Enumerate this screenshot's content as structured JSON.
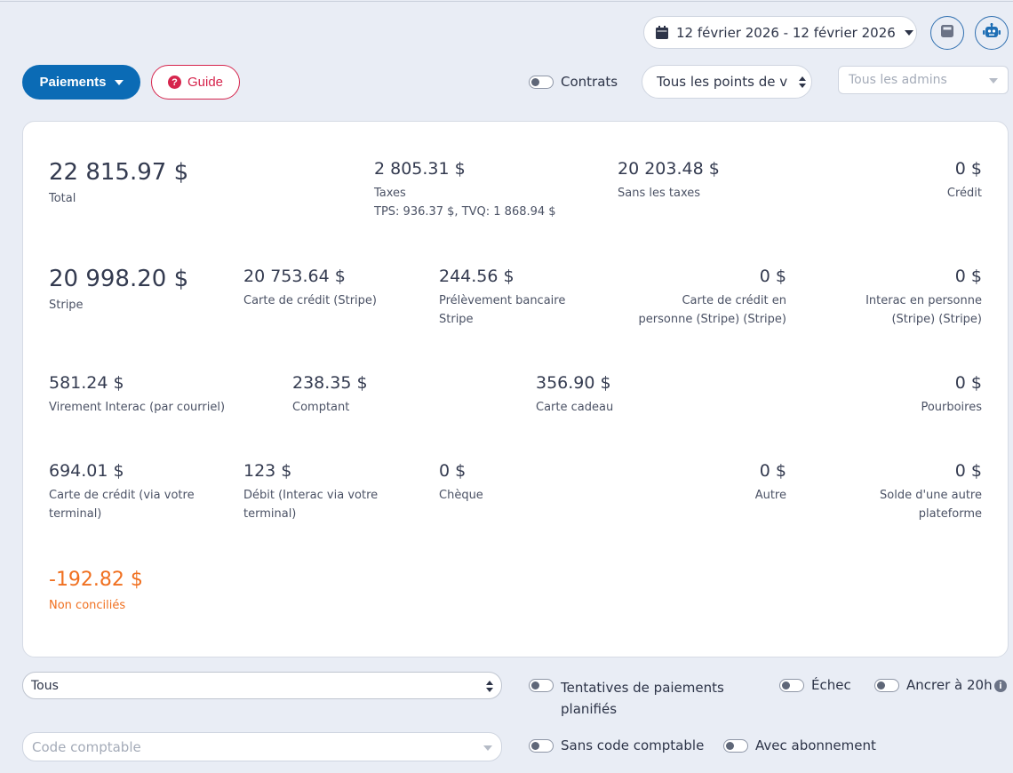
{
  "header": {
    "date_range": "12 février 2026 - 12 février 2026",
    "paiements_label": "Paiements",
    "guide_label": "Guide",
    "contrats_label": "Contrats",
    "points_de_vente_value": "Tous les points de v",
    "admins_placeholder": "Tous les admins"
  },
  "summary": {
    "total": {
      "value": "22 815.97 $",
      "label": "Total"
    },
    "taxes": {
      "value": "2 805.31 $",
      "label": "Taxes",
      "detail": "TPS: 936.37 $, TVQ: 1 868.94 $"
    },
    "sans_taxes": {
      "value": "20 203.48 $",
      "label": "Sans les taxes"
    },
    "credit": {
      "value": "0 $",
      "label": "Crédit"
    },
    "stripe": {
      "value": "20 998.20 $",
      "label": "Stripe"
    },
    "carte_credit_stripe": {
      "value": "20 753.64 $",
      "label": "Carte de crédit (Stripe)"
    },
    "prelevement": {
      "value": "244.56 $",
      "label1": "Prélèvement bancaire",
      "label2": "Stripe"
    },
    "carte_personne": {
      "value": "0 $",
      "label1": "Carte de crédit en",
      "label2": "personne (Stripe) (Stripe)"
    },
    "interac_personne": {
      "value": "0 $",
      "label1": "Interac en personne",
      "label2": "(Stripe) (Stripe)"
    },
    "virement": {
      "value": "581.24 $",
      "label": "Virement Interac (par courriel)"
    },
    "comptant": {
      "value": "238.35 $",
      "label": "Comptant"
    },
    "carte_cadeau": {
      "value": "356.90 $",
      "label": "Carte cadeau"
    },
    "pourboires": {
      "value": "0 $",
      "label": "Pourboires"
    },
    "carte_terminal": {
      "value": "694.01 $",
      "label1": "Carte de crédit (via votre",
      "label2": "terminal)"
    },
    "debit": {
      "value": "123 $",
      "label1": "Débit (Interac via votre",
      "label2": "terminal)"
    },
    "cheque": {
      "value": "0 $",
      "label": "Chèque"
    },
    "autre": {
      "value": "0 $",
      "label": "Autre"
    },
    "solde": {
      "value": "0 $",
      "label1": "Solde d'une autre",
      "label2": "plateforme"
    },
    "non_concilies": {
      "value": "-192.82 $",
      "label": "Non conciliés"
    }
  },
  "filters": {
    "type_value": "Tous",
    "code_placeholder": "Code comptable",
    "tentatives_label1": "Tentatives de paiements",
    "tentatives_label2": "planifiés",
    "echec_label": "Échec",
    "ancrer_label": "Ancrer à 20h",
    "sans_code_label": "Sans code comptable",
    "avec_abonnement_label": "Avec abonnement"
  },
  "colors": {
    "primary": "#0b6bb5",
    "guide": "#d6254d",
    "negative": "#f07020"
  }
}
